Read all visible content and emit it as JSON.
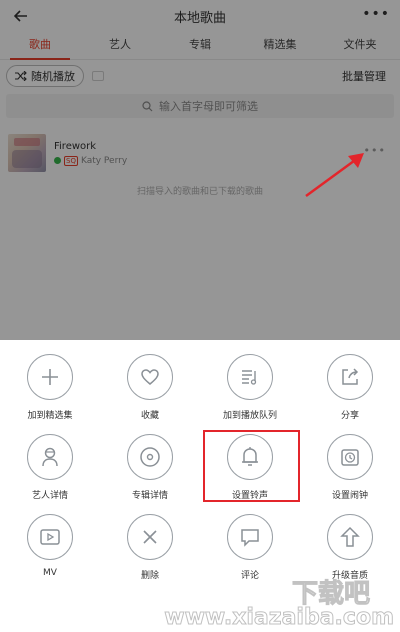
{
  "header": {
    "title": "本地歌曲"
  },
  "tabs": [
    {
      "label": "歌曲",
      "active": true
    },
    {
      "label": "艺人",
      "active": false
    },
    {
      "label": "专辑",
      "active": false
    },
    {
      "label": "精选集",
      "active": false
    },
    {
      "label": "文件夹",
      "active": false
    }
  ],
  "toolbar": {
    "shuffle_label": "随机播放",
    "batch_label": "批量管理"
  },
  "search": {
    "placeholder": "输入首字母即可筛选"
  },
  "song": {
    "title": "Firework",
    "artist": "Katy Perry"
  },
  "hint": "扫描导入的歌曲和已下载的歌曲",
  "actions": [
    {
      "label": "加到精选集",
      "icon": "plus-icon"
    },
    {
      "label": "收藏",
      "icon": "heart-icon"
    },
    {
      "label": "加到播放队列",
      "icon": "queue-icon"
    },
    {
      "label": "分享",
      "icon": "share-icon"
    },
    {
      "label": "艺人详情",
      "icon": "artist-icon"
    },
    {
      "label": "专辑详情",
      "icon": "album-icon"
    },
    {
      "label": "设置铃声",
      "icon": "bell-icon"
    },
    {
      "label": "设置闹钟",
      "icon": "alarm-icon"
    },
    {
      "label": "MV",
      "icon": "mv-icon"
    },
    {
      "label": "删除",
      "icon": "close-icon"
    },
    {
      "label": "评论",
      "icon": "comment-icon"
    },
    {
      "label": "升级音质",
      "icon": "upgrade-icon"
    }
  ],
  "colors": {
    "accent": "#e63f2b",
    "annotation": "#e3252b",
    "icon_stroke": "#9aa0a6"
  },
  "watermark": {
    "logo_text": "下载吧",
    "site_text": "www.xiazaiba.com"
  }
}
